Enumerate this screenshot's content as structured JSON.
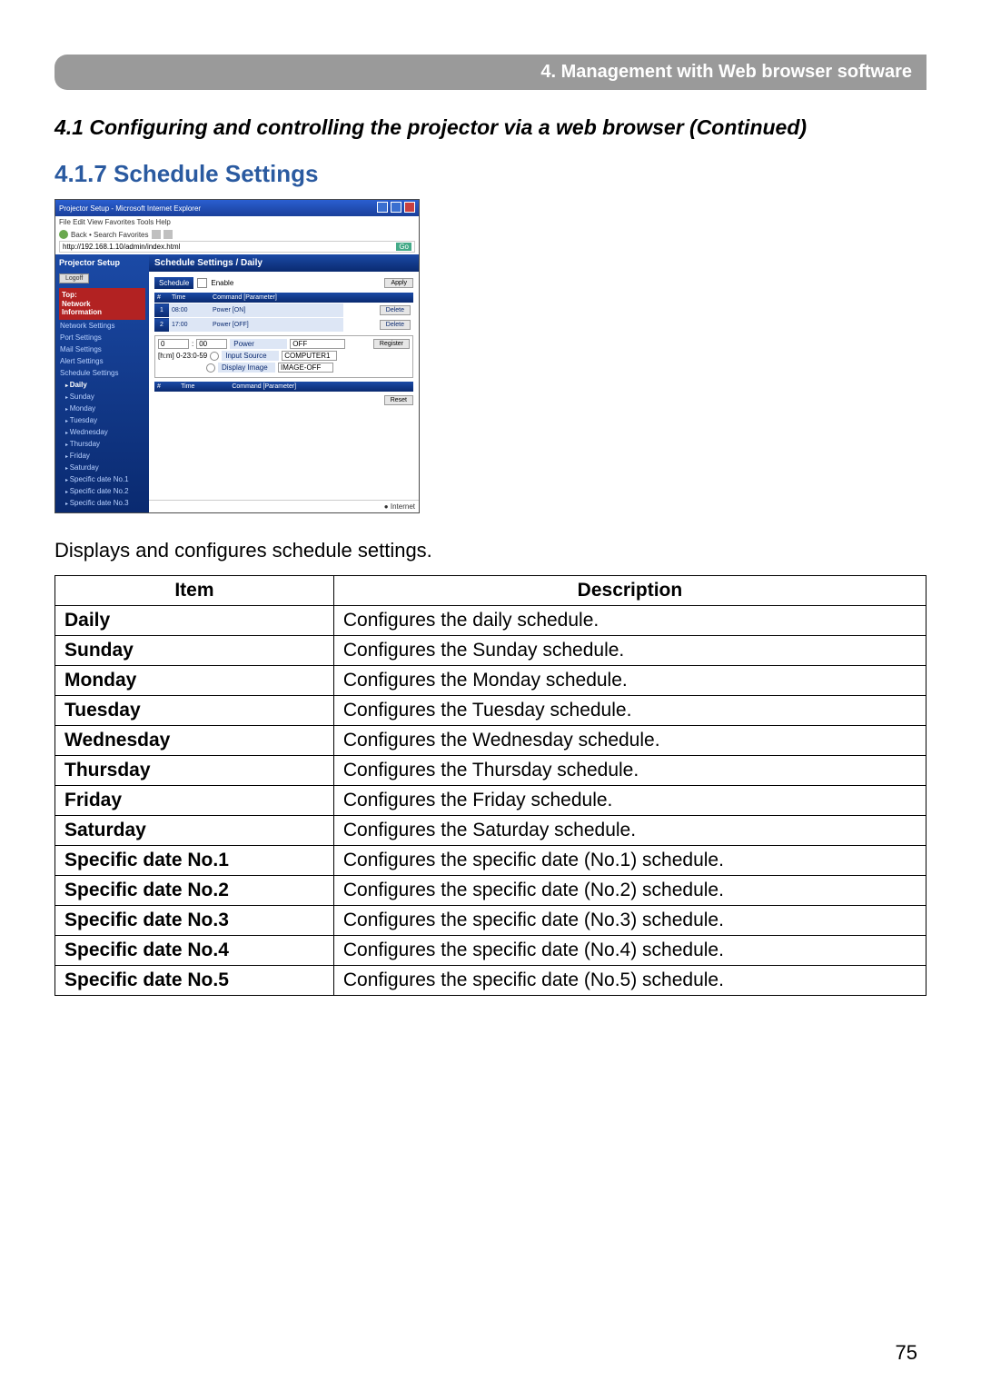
{
  "chapter_bar": "4. Management with Web browser software",
  "section_title": "4.1 Configuring and controlling the projector via a web browser (Continued)",
  "subsection_title": "4.1.7 Schedule Settings",
  "body_text": "Displays and configures schedule settings.",
  "page_number": "75",
  "screenshot": {
    "window_title": "Projector Setup - Microsoft Internet Explorer",
    "menubar": "File   Edit   View   Favorites   Tools   Help",
    "toolbar_text": "Back  •          Search   Favorites",
    "address": "http://192.168.1.10/admin/index.html",
    "go": "Go",
    "sidebar": {
      "title": "Projector Setup",
      "logoff": "Logoff",
      "topblock": "Top:\nNetwork\nInformation",
      "links": [
        "Network Settings",
        "Port Settings",
        "Mail Settings",
        "Alert Settings",
        "Schedule Settings"
      ],
      "sublinks": [
        "Daily",
        "Sunday",
        "Monday",
        "Tuesday",
        "Wednesday",
        "Thursday",
        "Friday",
        "Saturday",
        "Specific date No.1",
        "Specific date No.2",
        "Specific date No.3"
      ]
    },
    "main": {
      "pane_title": "Schedule Settings / Daily",
      "schedule_label": "Schedule",
      "enable_label": "Enable",
      "apply": "Apply",
      "register": "Register",
      "reset": "Reset",
      "table_headers": {
        "idx": "#",
        "time": "Time",
        "cmd": "Command [Parameter]"
      },
      "rows": [
        {
          "idx": "1",
          "time": "08:00",
          "cmd": "Power [ON]",
          "action": "Delete"
        },
        {
          "idx": "2",
          "time": "17:00",
          "cmd": "Power [OFF]",
          "action": "Delete"
        }
      ],
      "editor": {
        "time_hh": "0",
        "time_mm": "00",
        "hhmm_label": "[h:m] 0-23:0-59",
        "power_label": "Power",
        "power_value": "OFF",
        "input_label": "Input Source",
        "input_value": "COMPUTER1",
        "image_label": "Display Image",
        "image_value": "IMAGE-OFF"
      },
      "empty_header": {
        "idx": "#",
        "time": "Time",
        "cmd": "Command [Parameter]"
      }
    },
    "status": "Internet"
  },
  "desc_table": {
    "headers": {
      "item": "Item",
      "description": "Description"
    },
    "rows": [
      {
        "item": "Daily",
        "desc": "Configures the daily schedule."
      },
      {
        "item": "Sunday",
        "desc": "Configures the Sunday schedule."
      },
      {
        "item": "Monday",
        "desc": "Configures the Monday schedule."
      },
      {
        "item": "Tuesday",
        "desc": "Configures the Tuesday schedule."
      },
      {
        "item": "Wednesday",
        "desc": "Configures the Wednesday schedule."
      },
      {
        "item": "Thursday",
        "desc": "Configures the Thursday schedule."
      },
      {
        "item": "Friday",
        "desc": "Configures the Friday schedule."
      },
      {
        "item": "Saturday",
        "desc": "Configures the Saturday schedule."
      },
      {
        "item": "Specific date No.1",
        "desc": "Configures the specific date (No.1) schedule."
      },
      {
        "item": "Specific date No.2",
        "desc": "Configures the specific date (No.2) schedule."
      },
      {
        "item": "Specific date No.3",
        "desc": "Configures the specific date (No.3) schedule."
      },
      {
        "item": "Specific date No.4",
        "desc": "Configures the specific date (No.4) schedule."
      },
      {
        "item": "Specific date No.5",
        "desc": "Configures the specific date (No.5) schedule."
      }
    ]
  }
}
